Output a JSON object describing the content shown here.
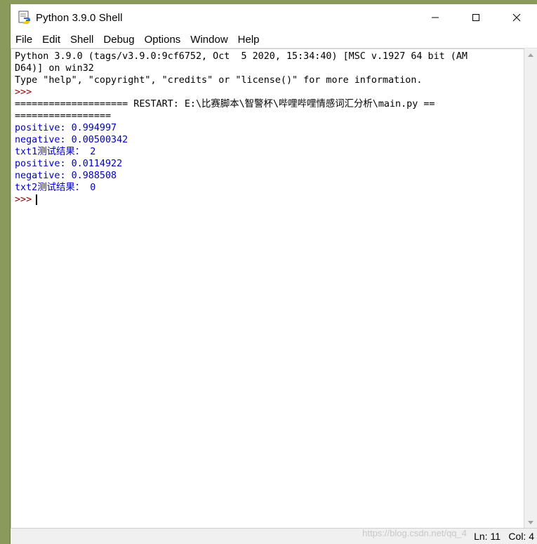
{
  "window": {
    "title": "Python 3.9.0 Shell",
    "icon": "python-idle-icon",
    "controls": [
      "minimize-icon",
      "maximize-icon",
      "close-icon"
    ]
  },
  "menu": [
    "File",
    "Edit",
    "Shell",
    "Debug",
    "Options",
    "Window",
    "Help"
  ],
  "shell": {
    "banner_1": "Python 3.9.0 (tags/v3.9.0:9cf6752, Oct  5 2020, 15:34:40) [MSC v.1927 64 bit (AM",
    "banner_2": "D64)] on win32",
    "banner_3": "Type \"help\", \"copyright\", \"credits\" or \"license()\" for more information.",
    "prompt": ">>>",
    "restart_1": "==================== RESTART: E:\\比赛脚本\\智警杯\\哔哩哔哩情感词汇分析\\main.py ==",
    "restart_2": "=================",
    "output": [
      "positive: 0.994997",
      "negative: 0.00500342",
      "txt1测试结果： 2",
      "positive: 0.0114922",
      "negative: 0.988508",
      "txt2测试结果： 0"
    ]
  },
  "status": {
    "ln": "Ln: 11",
    "col": "Col: 4"
  },
  "watermark": "https://blog.csdn.net/qq_4",
  "colors": {
    "output": "#0000c0",
    "prompt": "#8b0000",
    "background": "#ffffff"
  }
}
